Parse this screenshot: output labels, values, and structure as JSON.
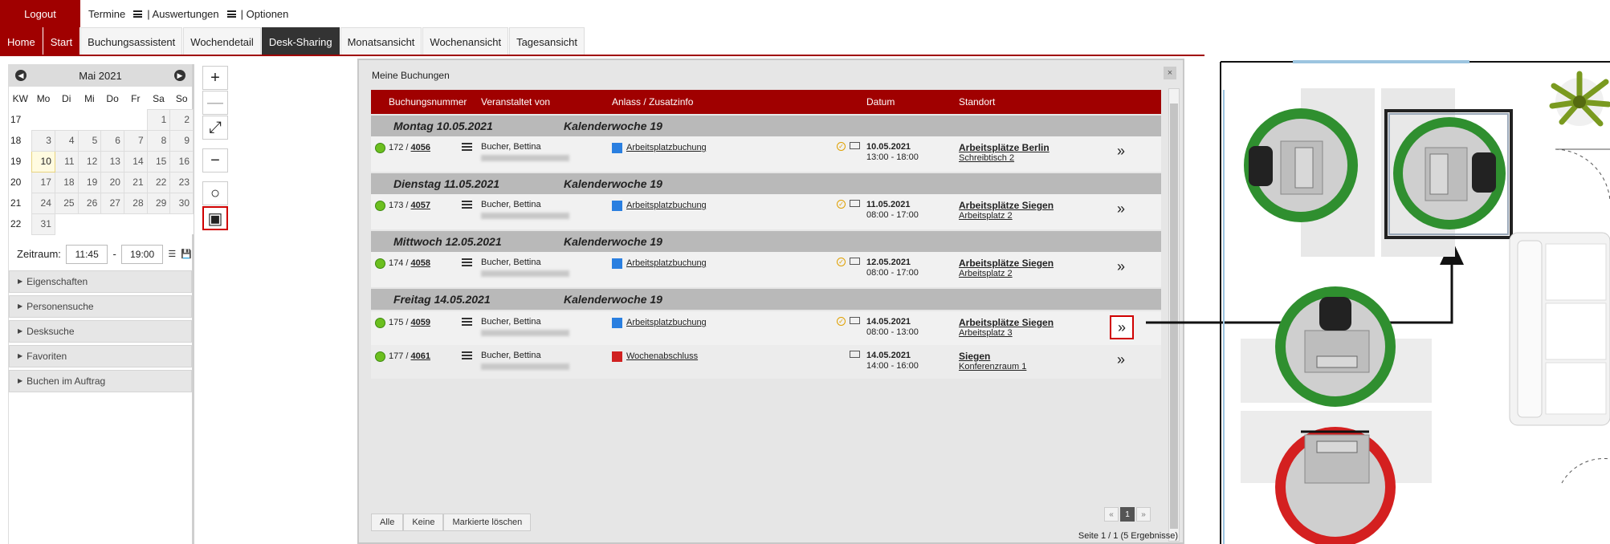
{
  "header": {
    "logout": "Logout",
    "menu": [
      {
        "label": "Termine"
      },
      {
        "label": "| Auswertungen"
      },
      {
        "label": "| Optionen"
      }
    ]
  },
  "tabs": [
    {
      "label": "Home",
      "style": "red"
    },
    {
      "label": "Start",
      "style": "red"
    },
    {
      "label": "Buchungsassistent",
      "style": "normal"
    },
    {
      "label": "Wochendetail",
      "style": "normal"
    },
    {
      "label": "Desk-Sharing",
      "style": "active"
    },
    {
      "label": "Monatsansicht",
      "style": "normal"
    },
    {
      "label": "Wochenansicht",
      "style": "normal"
    },
    {
      "label": "Tagesansicht",
      "style": "normal"
    }
  ],
  "calendar": {
    "month": "Mai 2021",
    "weekdays": [
      "KW",
      "Mo",
      "Di",
      "Mi",
      "Do",
      "Fr",
      "Sa",
      "So"
    ],
    "weeks": [
      {
        "kw": "17",
        "days": [
          "",
          "",
          "",
          "",
          "",
          "1",
          "2"
        ]
      },
      {
        "kw": "18",
        "days": [
          "3",
          "4",
          "5",
          "6",
          "7",
          "8",
          "9"
        ]
      },
      {
        "kw": "19",
        "days": [
          "10",
          "11",
          "12",
          "13",
          "14",
          "15",
          "16"
        ]
      },
      {
        "kw": "20",
        "days": [
          "17",
          "18",
          "19",
          "20",
          "21",
          "22",
          "23"
        ]
      },
      {
        "kw": "21",
        "days": [
          "24",
          "25",
          "26",
          "27",
          "28",
          "29",
          "30"
        ]
      },
      {
        "kw": "22",
        "days": [
          "31",
          "",
          "",
          "",
          "",
          "",
          ""
        ]
      }
    ],
    "today": "10"
  },
  "zeitraum": {
    "label": "Zeitraum:",
    "from": "11:45",
    "sep": "-",
    "to": "19:00"
  },
  "accordion": [
    "Eigenschaften",
    "Personensuche",
    "Desksuche",
    "Favoriten",
    "Buchen im Auftrag"
  ],
  "tools": [
    {
      "name": "zoom-in-button",
      "glyph": "+"
    },
    {
      "name": "zoom-out-disabled-button",
      "glyph": "—"
    },
    {
      "name": "fit-view-button",
      "glyph": "⤢"
    },
    {
      "name": "minus-button",
      "glyph": "−"
    },
    {
      "name": "circle-tool-button",
      "glyph": "○"
    },
    {
      "name": "my-bookings-button",
      "glyph": "▣"
    }
  ],
  "dialog": {
    "title": "Meine Buchungen",
    "close": "×",
    "columns": [
      "Buchungsnummer",
      "Veranstaltet von",
      "Anlass / Zusatzinfo",
      "Datum",
      "Standort"
    ],
    "groups": [
      {
        "day": "Montag 10.05.2021",
        "week": "Kalenderwoche 19",
        "rows": [
          {
            "nr": "172 / ",
            "nr_link": "4056",
            "by": "Bucher, Bettina",
            "type": "blue",
            "anlass": "Arbeitsplatzbuchung",
            "clock": true,
            "date": "10.05.2021",
            "time": "13:00 - 18:00",
            "loc": "Arbeitsplätze Berlin",
            "place": "Schreibtisch 2",
            "go": "»"
          }
        ]
      },
      {
        "day": "Dienstag 11.05.2021",
        "week": "Kalenderwoche 19",
        "rows": [
          {
            "nr": "173 / ",
            "nr_link": "4057",
            "by": "Bucher, Bettina",
            "type": "blue",
            "anlass": "Arbeitsplatzbuchung",
            "clock": true,
            "date": "11.05.2021",
            "time": "08:00 - 17:00",
            "loc": "Arbeitsplätze Siegen",
            "place": "Arbeitsplatz 2",
            "go": "»"
          }
        ]
      },
      {
        "day": "Mittwoch 12.05.2021",
        "week": "Kalenderwoche 19",
        "rows": [
          {
            "nr": "174 / ",
            "nr_link": "4058",
            "by": "Bucher, Bettina",
            "type": "blue",
            "anlass": "Arbeitsplatzbuchung",
            "clock": true,
            "date": "12.05.2021",
            "time": "08:00 - 17:00",
            "loc": "Arbeitsplätze Siegen",
            "place": "Arbeitsplatz 2",
            "go": "»"
          }
        ]
      },
      {
        "day": "Freitag 14.05.2021",
        "week": "Kalenderwoche 19",
        "rows": [
          {
            "nr": "175 / ",
            "nr_link": "4059",
            "by": "Bucher, Bettina",
            "type": "blue",
            "anlass": "Arbeitsplatzbuchung",
            "clock": true,
            "date": "14.05.2021",
            "time": "08:00 - 13:00",
            "loc": "Arbeitsplätze Siegen",
            "place": "Arbeitsplatz 3",
            "go": "»",
            "highlight": true
          },
          {
            "nr": "177 / ",
            "nr_link": "4061",
            "by": "Bucher, Bettina",
            "type": "red",
            "anlass": "Wochenabschluss",
            "clock": false,
            "date": "14.05.2021",
            "time": "14:00 - 16:00",
            "loc": "Siegen",
            "place": "Konferenzraum 1",
            "go": "»"
          }
        ]
      }
    ],
    "footer_buttons": [
      "Alle",
      "Keine",
      "Markierte löschen"
    ],
    "pager": {
      "prev": "«",
      "page": "1",
      "next": "»",
      "info": "Seite 1 / 1 (5 Ergebnisse)"
    }
  },
  "colors": {
    "brand_red": "#a00000",
    "free_green": "#2f8f2f",
    "occupied_red": "#d42020",
    "status_green": "#6cbf1f"
  }
}
